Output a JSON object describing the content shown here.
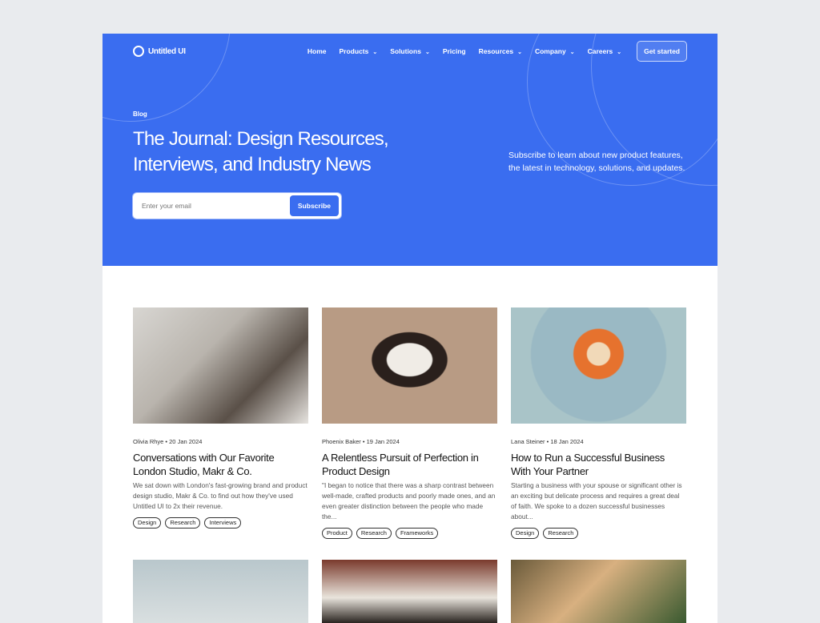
{
  "brand": {
    "name": "Untitled UI",
    "accent": "#3a6df0"
  },
  "nav": {
    "items": [
      {
        "label": "Home",
        "dropdown": false
      },
      {
        "label": "Products",
        "dropdown": true
      },
      {
        "label": "Solutions",
        "dropdown": true
      },
      {
        "label": "Pricing",
        "dropdown": false
      },
      {
        "label": "Resources",
        "dropdown": true
      },
      {
        "label": "Company",
        "dropdown": true
      },
      {
        "label": "Careers",
        "dropdown": true
      }
    ],
    "cta": "Get started"
  },
  "hero": {
    "eyebrow": "Blog",
    "title": "The Journal: Design Resources, Interviews, and Industry News",
    "subtitle": "Subscribe to learn about new product features, the latest in technology, solutions, and updates.",
    "email_placeholder": "Enter your email",
    "subscribe": "Subscribe"
  },
  "posts": [
    {
      "meta": "Olivia Rhye • 20 Jan 2024",
      "title": "Conversations with Our Favorite London Studio, Makr & Co.",
      "excerpt": "We sat down with London's fast-growing brand and product design studio, Makr & Co. to find out how they've used Untitled UI to 2x their revenue.",
      "tags": [
        "Design",
        "Research",
        "Interviews"
      ]
    },
    {
      "meta": "Phoenix Baker • 19 Jan 2024",
      "title": "A Relentless Pursuit of Perfection in Product Design",
      "excerpt": "\"I began to notice that there was a sharp contrast between well-made, crafted products and poorly made ones, and an even greater distinction between the people who made the...",
      "tags": [
        "Product",
        "Research",
        "Frameworks"
      ]
    },
    {
      "meta": "Lana Steiner • 18 Jan 2024",
      "title": "How to Run a Successful Business With Your Partner",
      "excerpt": "Starting a business with your spouse or significant other is an exciting but delicate process and requires a great deal of faith. We spoke to a dozen successful businesses about...",
      "tags": [
        "Design",
        "Research"
      ]
    }
  ]
}
